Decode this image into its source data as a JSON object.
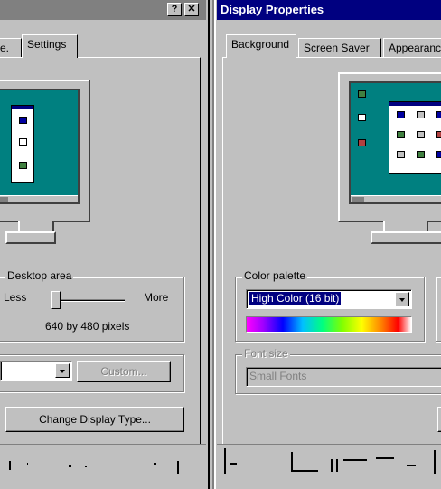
{
  "left_panel": {
    "tabs": [
      "e.",
      "Settings"
    ],
    "desktop_area": {
      "group_label": "Desktop area",
      "less_label": "Less",
      "more_label": "More",
      "resolution_text": "640 by 480 pixels",
      "slider_value_fraction": 0
    },
    "custom_button": "Custom...",
    "change_display_type_button": "Change Display Type..."
  },
  "right_panel": {
    "title": "Display Properties",
    "tabs": [
      "Background",
      "Screen Saver",
      "Appearance"
    ],
    "color_palette": {
      "group_label": "Color palette",
      "selected_value": "High Color (16 bit)"
    },
    "font_size": {
      "group_label": "Font size",
      "value": "Small Fonts"
    }
  },
  "titlebar_buttons": {
    "help_label": "?",
    "close_label": "✕"
  },
  "colors": {
    "title_active": "#000080",
    "face": "#c0c0c0",
    "desktop": "#008080",
    "highlight": "#000080"
  },
  "icons": [
    "help-icon",
    "close-icon",
    "dropdown-arrow-icon",
    "monitor-icon"
  ]
}
